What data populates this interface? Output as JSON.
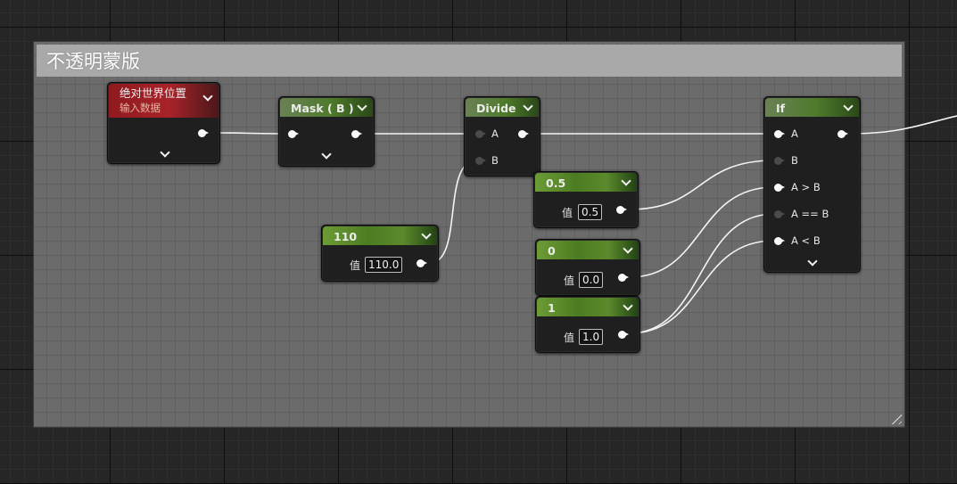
{
  "comment": {
    "title": "不透明蒙版"
  },
  "nodes": {
    "absolute_world_position": {
      "title": "绝对世界位置",
      "subtitle": "输入数据"
    },
    "mask": {
      "title": "Mask ( B )"
    },
    "divide": {
      "title": "Divide",
      "pin_a": "A",
      "pin_b": "B"
    },
    "const_110": {
      "title": "110",
      "value_label": "值",
      "value": "110.0"
    },
    "const_05": {
      "title": "0.5",
      "value_label": "值",
      "value": "0.5"
    },
    "const_0": {
      "title": "0",
      "value_label": "值",
      "value": "0.0"
    },
    "const_1": {
      "title": "1",
      "value_label": "值",
      "value": "1.0"
    },
    "if": {
      "title": "If",
      "pin_a": "A",
      "pin_b": "B",
      "pin_agb": "A > B",
      "pin_aeb": "A == B",
      "pin_alb": "A < B"
    }
  },
  "colors": {
    "canvas": "#262626",
    "comment_body": "#6b6b6b",
    "comment_title": "#a9a9a9",
    "header_green": "#4e7a2b",
    "header_red": "#a8232a",
    "wire": "#ffffff"
  }
}
